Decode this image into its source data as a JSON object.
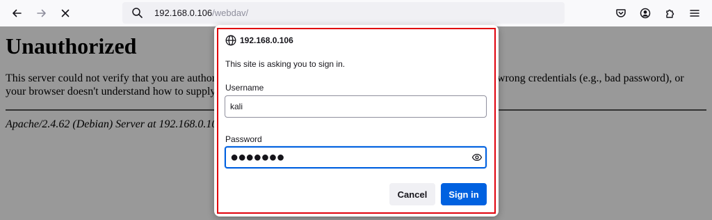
{
  "toolbar": {
    "back_icon": "arrow-left-icon",
    "forward_icon": "arrow-right-icon",
    "stop_icon": "close-icon",
    "pocket_icon": "pocket-icon",
    "account_icon": "account-icon",
    "extensions_icon": "puzzle-icon",
    "menu_icon": "hamburger-menu-icon"
  },
  "urlbar": {
    "host": "192.168.0.106",
    "path": "/webdav/"
  },
  "page": {
    "title": "Unauthorized",
    "message": "This server could not verify that you are authorized to access the document requested. Either you supplied the wrong credentials (e.g., bad password), or your browser doesn't understand how to supply the credentials required.",
    "address": "Apache/2.4.62 (Debian) Server at 192.168.0.106 Port 80"
  },
  "dialog": {
    "host": "192.168.0.106",
    "description": "This site is asking you to sign in.",
    "username_label": "Username",
    "username_value": "kali",
    "password_label": "Password",
    "password_mask": "●●●●●●●",
    "cancel_label": "Cancel",
    "signin_label": "Sign in"
  },
  "colors": {
    "accent": "#0061e0",
    "highlight_border": "#e0000b",
    "overlay": "rgba(0,0,0,0.4)"
  }
}
